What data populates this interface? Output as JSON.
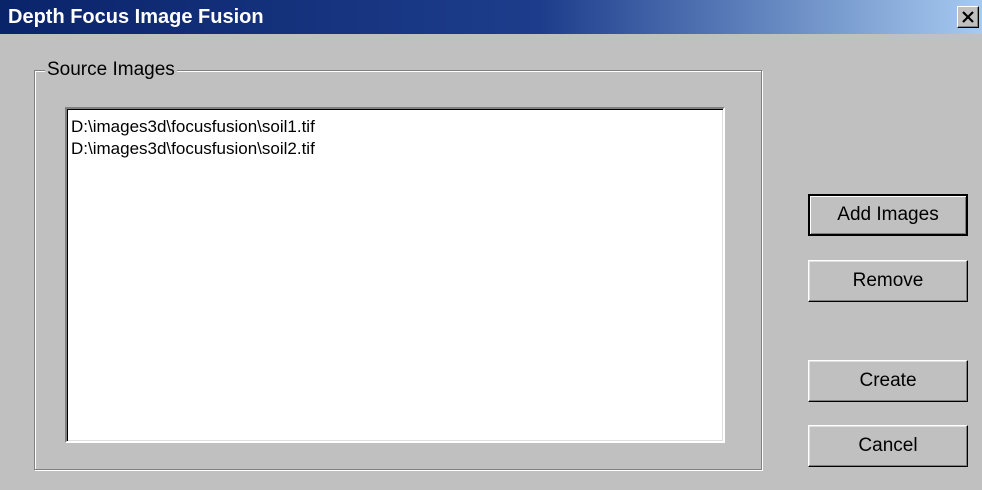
{
  "window": {
    "title": "Depth Focus Image Fusion"
  },
  "icons": {
    "close": "close-icon"
  },
  "source_images": {
    "group_label": "Source Images",
    "items": [
      "D:\\images3d\\focusfusion\\soil1.tif",
      "D:\\images3d\\focusfusion\\soil2.tif"
    ]
  },
  "buttons": {
    "add_images": "Add Images",
    "remove": "Remove",
    "create": "Create",
    "cancel": "Cancel"
  },
  "colors": {
    "titlebar_start": "#0a246a",
    "titlebar_end": "#a6caf0",
    "face": "#c0c0c0"
  }
}
